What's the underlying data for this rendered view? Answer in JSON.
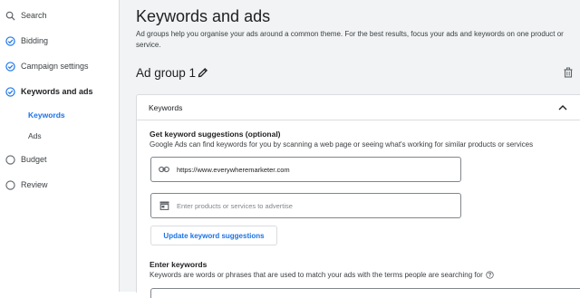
{
  "sidebar": {
    "items": [
      {
        "label": "Search",
        "icon": "search-icon"
      },
      {
        "label": "Bidding",
        "icon": "check-circle-icon"
      },
      {
        "label": "Campaign settings",
        "icon": "check-circle-icon"
      },
      {
        "label": "Keywords and ads",
        "icon": "check-circle-icon"
      },
      {
        "label": "Budget",
        "icon": "empty-circle-icon"
      },
      {
        "label": "Review",
        "icon": "empty-circle-icon"
      }
    ],
    "subitems": [
      {
        "label": "Keywords",
        "active": true
      },
      {
        "label": "Ads",
        "active": false
      }
    ]
  },
  "main": {
    "title": "Keywords and ads",
    "description": "Ad groups help you organise your ads around a common theme. For the best results, focus your ads and keywords on one product or service.",
    "ad_group": {
      "title": "Ad group 1",
      "edit_icon": "pencil-icon",
      "delete_icon": "trash-icon"
    },
    "card": {
      "header": "Keywords",
      "suggestions": {
        "title": "Get keyword suggestions (optional)",
        "description": "Google Ads can find keywords for you by scanning a web page or seeing what's working for similar products or services",
        "url_value": "https://www.everywheremarketer.com",
        "url_icon": "link-icon",
        "products_placeholder": "Enter products or services to advertise",
        "products_icon": "store-icon",
        "button_label": "Update keyword suggestions"
      },
      "enter_keywords": {
        "title": "Enter keywords",
        "description": "Keywords are words or phrases that are used to match your ads with the terms people are searching for"
      }
    }
  },
  "colors": {
    "accent": "#1a73e8",
    "background": "#f1f3f4",
    "text": "#202124"
  }
}
